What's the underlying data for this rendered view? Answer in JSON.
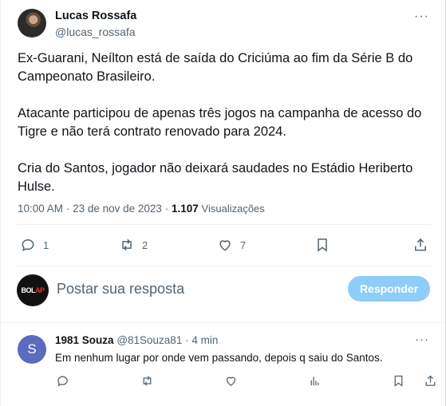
{
  "tweet": {
    "author_name": "Lucas Rossafa",
    "author_handle": "@lucas_rossafa",
    "more_glyph": "···",
    "paragraphs": [
      "Ex-Guarani, Neílton está de saída do Criciúma ao fim da Série B do Campeonato Brasileiro.",
      "Atacante participou de apenas três jogos na campanha de acesso do Tigre e não terá contrato renovado para 2024.",
      "Cria do Santos, jogador não deixará saudades no Estádio Heriberto Hulse."
    ],
    "time": "10:00 AM",
    "sep": "·",
    "date": "23 de nov de 2023",
    "views_count": "1.107",
    "views_label": "Visualizações",
    "actions": {
      "reply_count": "1",
      "retweet_count": "2",
      "like_count": "7"
    }
  },
  "composer": {
    "avatar_text_a": "BOL",
    "avatar_text_b": "AP",
    "placeholder": "Postar sua resposta",
    "button_label": "Responder",
    "button_color": "#8ecdf7"
  },
  "reply": {
    "avatar_letter": "S",
    "avatar_color": "#5c6bc0",
    "author_name": "1981 Souza",
    "author_handle": "@81Souza81",
    "sep": "·",
    "age": "4 min",
    "more_glyph": "···",
    "text": "Em nenhum lugar por onde vem passando, depois q saiu do Santos."
  },
  "colors": {
    "text": "#0f1419",
    "secondary": "#536471",
    "divider": "#eff3f4"
  }
}
